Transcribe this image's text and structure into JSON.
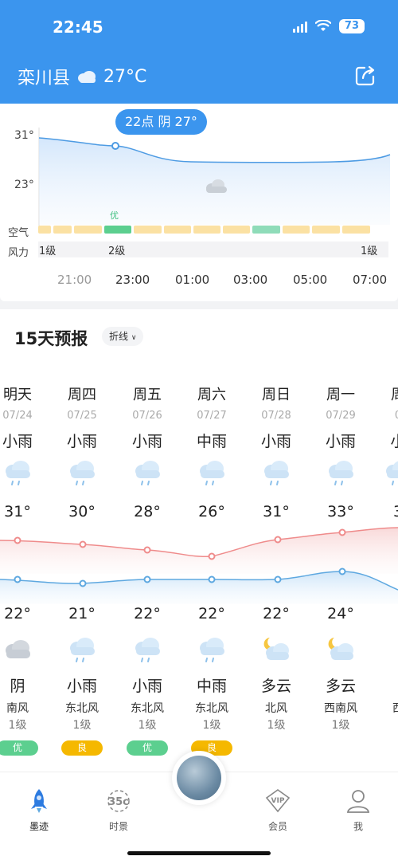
{
  "status": {
    "time": "22:45",
    "battery": "73"
  },
  "header": {
    "city": "栾川县",
    "temp": "27°C"
  },
  "hourly": {
    "y_max_label": "31°",
    "y_min_label": "23°",
    "tooltip": "22点 阴 27°",
    "air_label": "空气",
    "wind_label": "风力",
    "aqi_top": "优",
    "wind_levels": [
      "1级",
      "2级",
      "1级"
    ],
    "hours": [
      "21:00",
      "23:00",
      "01:00",
      "03:00",
      "05:00",
      "07:00"
    ]
  },
  "forecast": {
    "title": "15天预报",
    "mode": "折线",
    "days": [
      {
        "name": "明天",
        "date": "07/24",
        "cond": "小雨",
        "high": "31°",
        "low": "22°",
        "night": "阴",
        "wind": "南风",
        "lvl": "1级",
        "aqi": "优"
      },
      {
        "name": "周四",
        "date": "07/25",
        "cond": "小雨",
        "high": "30°",
        "low": "21°",
        "night": "小雨",
        "wind": "东北风",
        "lvl": "1级",
        "aqi": "良"
      },
      {
        "name": "周五",
        "date": "07/26",
        "cond": "小雨",
        "high": "28°",
        "low": "22°",
        "night": "小雨",
        "wind": "东北风",
        "lvl": "1级",
        "aqi": "优"
      },
      {
        "name": "周六",
        "date": "07/27",
        "cond": "中雨",
        "high": "26°",
        "low": "22°",
        "night": "中雨",
        "wind": "东北风",
        "lvl": "1级",
        "aqi": "良"
      },
      {
        "name": "周日",
        "date": "07/28",
        "cond": "小雨",
        "high": "31°",
        "low": "22°",
        "night": "多云",
        "wind": "北风",
        "lvl": "1级",
        "aqi": ""
      },
      {
        "name": "周一",
        "date": "07/29",
        "cond": "小雨",
        "high": "33°",
        "low": "24°",
        "night": "多云",
        "wind": "西南风",
        "lvl": "1级",
        "aqi": ""
      },
      {
        "name": "周",
        "date": "0",
        "cond": "小",
        "high": "3",
        "low": "",
        "night": "",
        "wind": "西",
        "lvl": "",
        "aqi": ""
      }
    ]
  },
  "nav": {
    "items": [
      "墨迹",
      "时景",
      "会员",
      "我"
    ]
  },
  "colors": {
    "brand": "#3b95ee",
    "aqi_good": "#5ccf8f",
    "aqi_ok": "#f5b800",
    "high_line": "#ef8b8b",
    "low_line": "#5ea8e0"
  }
}
